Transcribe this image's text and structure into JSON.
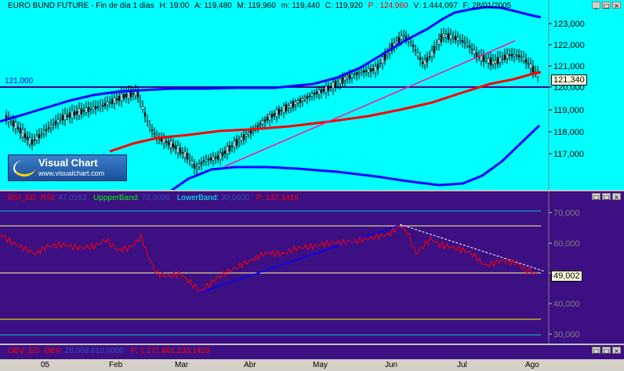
{
  "top_panel": {
    "header": {
      "title": "EURO BUND FUTURE - Fin de día 1 días",
      "h": "H: 19:00",
      "a": "A: 119,480",
      "m": "M: 119,960",
      "mlow": "m: 119,440",
      "c": "C: 119,920",
      "p": "P : 124,960",
      "v": "V: 1.444,097",
      "date": "F: 28/01/2005"
    },
    "hline_label": "121,000",
    "last_value": "121,340",
    "y_ticks": [
      "123,000",
      "122,000",
      "121,000",
      "120,000",
      "119,000",
      "118,000",
      "117,000"
    ],
    "logo": {
      "name": "Visual Chart",
      "url": "www.visualchart.com"
    }
  },
  "middle_panel": {
    "header": {
      "rsi_name": "RSI_ED",
      "rsi_label": "RSI:",
      "rsi_value": "47,0553",
      "upper_label": "UppperBand:",
      "upper_value": "70,0000",
      "lower_label": "LowerBand:",
      "lower_value": "30,0000",
      "p": "P: 137,3418"
    },
    "last_value": "49,002",
    "y_ticks": [
      "70,000",
      "60,000",
      "50,000",
      "40,000",
      "30,000"
    ]
  },
  "bottom_panel": {
    "header": {
      "obv_name": "OBV_ED",
      "obv_label": "OBV:",
      "obv_value": "28.008.810,0000",
      "p": "P: 1.171.801.233,1429"
    }
  },
  "x_axis": {
    "labels": [
      "05",
      "Feb",
      "Mar",
      "Abr",
      "May",
      "Jun",
      "Jul",
      "Ago"
    ]
  },
  "colors": {
    "top_bg": "#00ffff",
    "rsi_bg": "#3c0f82",
    "obv_bg": "#3c0f82",
    "price_bands": "#0000ff",
    "ma_red": "#ff0000",
    "trend_pink": "#ff1493",
    "rsi_line": "#ff0000"
  }
}
